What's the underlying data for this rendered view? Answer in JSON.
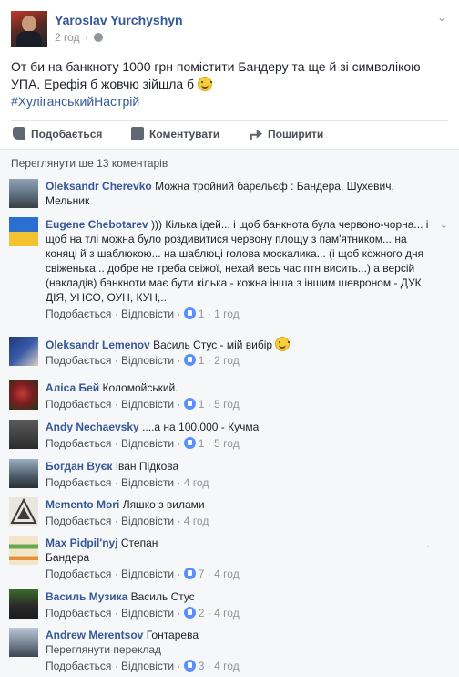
{
  "post": {
    "author": "Yaroslav Yurchyshyn",
    "time": "2 год",
    "text_line1": "От би на банкноту 1000 грн помістити Бандеру та ще й зі символікою",
    "text_line2": "УПА. Ерефія б жовчю зійшла б",
    "hashtag": "#ХуліганськийНастрій"
  },
  "actions": {
    "like": "Подобається",
    "comment": "Коментувати",
    "share": "Поширити"
  },
  "view_more": "Переглянути ще 13 коментарів",
  "reply_label": "Відповісти",
  "like_label": "Подобається",
  "comments": [
    {
      "name": "Oleksandr Cherevko",
      "text": "Можна тройний барельєф : Бандера, Шухевич, Мельник",
      "likes": "",
      "time": ""
    },
    {
      "name": "Eugene Chebotarev",
      "text": "))) Кілька ідей... і щоб банкнота була червоно-чорна... і щоб на тлі можна було роздивитися червону площу з пам'ятником... на коняці й з шаблюкою... на шаблюці голова москалика... (і щоб кожного дня свіженька... добре не треба свіжої, нехай весь час птн висить...) а версій (накладів) банкноти має бути кілька - кожна інша з іншим шевроном - ДУК, ДІЯ, УНСО, ОУН, КУН,..",
      "likes": "1",
      "time": "1 год"
    },
    {
      "name": "Oleksandr Lemenov",
      "text": "Василь Стус - мій вибір",
      "likes": "1",
      "time": "2 год"
    },
    {
      "name": "Аліса Бей",
      "text": "Коломойський.",
      "likes": "1",
      "time": "5 год"
    },
    {
      "name": "Andy Nechaevsky",
      "text": "....а на 100.000 - Кучма",
      "likes": "1",
      "time": "5 год"
    },
    {
      "name": "Богдан Вуєк",
      "text": "Іван Підкова",
      "likes": "",
      "time": "4 год"
    },
    {
      "name": "Memento Mori",
      "text": "Ляшко з вилами",
      "likes": "",
      "time": "4 год"
    },
    {
      "name": "Max Pidpil'nyj",
      "text": "Степан",
      "text2": "Бандера",
      "likes": "7",
      "time": "4 год"
    },
    {
      "name": "Василь Музика",
      "text": "Василь Стус",
      "likes": "2",
      "time": "4 год"
    },
    {
      "name": "Andrew Merentsov",
      "text": "Гонтарева",
      "see_translation": "Переглянути переклад",
      "likes": "3",
      "time": "4 год"
    }
  ],
  "colors": {
    "link": "#365899",
    "meta": "#90949c",
    "comments_bg": "#f6f7f9",
    "like_blue": "#5890ff"
  }
}
